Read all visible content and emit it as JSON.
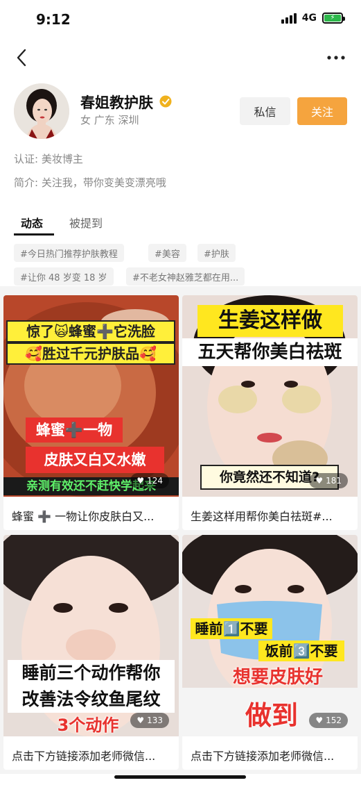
{
  "status_bar": {
    "time": "9:12",
    "network": "4G",
    "battery_icon": "battery-charging-icon"
  },
  "nav": {
    "back_icon": "chevron-left-icon",
    "more_icon": "more-dots-icon"
  },
  "profile": {
    "name": "春姐教护肤",
    "verified_icon": "verified-badge-icon",
    "meta": "女 广东 深圳",
    "message_label": "私信",
    "follow_label": "关注",
    "certification": "认证: 美妆博主",
    "bio": "简介: 关注我，带你变美变漂亮哦"
  },
  "tabs": [
    {
      "label": "动态",
      "active": true
    },
    {
      "label": "被提到",
      "active": false
    }
  ],
  "tags": [
    "#今日热门推荐护肤教程",
    "#美容",
    "#护肤",
    "#让你 48 岁变 18 岁",
    "#不老女神赵雅芝都在用..."
  ],
  "colors": {
    "accent": "#f5a43e",
    "verified": "#f0b21e",
    "overlay_yellow": "#ffe71f",
    "overlay_red": "#e8322e"
  },
  "posts": [
    {
      "title": "蜂蜜 ➕ 一物让你皮肤白又...",
      "likes": "124",
      "overlay": {
        "line1": "惊了🙀蜂蜜➕它洗脸",
        "line2": "🥰胜过千元护肤品🥰",
        "line3": "蜂蜜➕一物",
        "line4": "皮肤又白又水嫩",
        "line5": "亲测有效还不赶快学起来"
      }
    },
    {
      "title": "生姜这样用帮你美白祛斑#...",
      "likes": "181",
      "overlay": {
        "line1": "生姜这样做",
        "line2": "五天帮你美白祛斑",
        "line3": "你竟然还不知道?"
      }
    },
    {
      "title": "点击下方链接添加老师微信...",
      "likes": "133",
      "overlay": {
        "line1": "睡前三个动作帮你",
        "line2": "改善法令纹鱼尾纹",
        "line3": "3个动作"
      }
    },
    {
      "title": "点击下方链接添加老师微信...",
      "likes": "152",
      "overlay": {
        "line1": "睡前1️⃣不要",
        "line2": "饭前3️⃣不要",
        "line3": "想要皮肤好",
        "line4": "做到"
      }
    }
  ]
}
